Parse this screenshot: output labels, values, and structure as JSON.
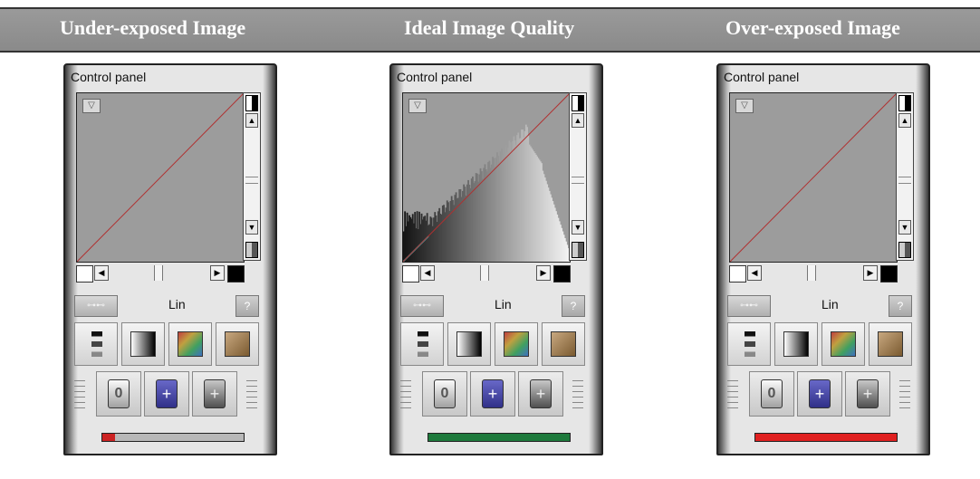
{
  "headers": [
    "Under-exposed Image",
    "Ideal Image Quality",
    "Over-exposed Image"
  ],
  "panels": [
    {
      "title": "Control panel",
      "mode": "Lin",
      "histogram": false,
      "exposure_fraction": 0.09,
      "bar_color": "#cc2222",
      "bar_track": "#b8b8b8"
    },
    {
      "title": "Control panel",
      "mode": "Lin",
      "histogram": true,
      "exposure_fraction": 1.0,
      "bar_color": "#1e7a3c",
      "bar_track": "#b8b8b8"
    },
    {
      "title": "Control panel",
      "mode": "Lin",
      "histogram": false,
      "exposure_fraction": 1.0,
      "bar_color": "#e02020",
      "bar_track": "#b8b8b8"
    }
  ],
  "icons": {
    "dropdown": "chevron-down-icon",
    "link": "link-icon",
    "help": "help-icon",
    "tools": [
      "levels-icon",
      "gradient-icon",
      "rgb-gradient-icon",
      "sepia-icon"
    ],
    "modes": [
      "zero-icon",
      "crosshair-icon",
      "split-icon"
    ]
  },
  "colors": {
    "curve": "#b03030",
    "header_bg": "#919191",
    "teal": "#3cc8c8"
  },
  "glyphs": {
    "dropdown": "▽",
    "link": "⊶⊷",
    "help": "?",
    "up": "▲",
    "down": "▼",
    "left": "◀",
    "right": "▶",
    "zero": "0",
    "plus": "+"
  }
}
